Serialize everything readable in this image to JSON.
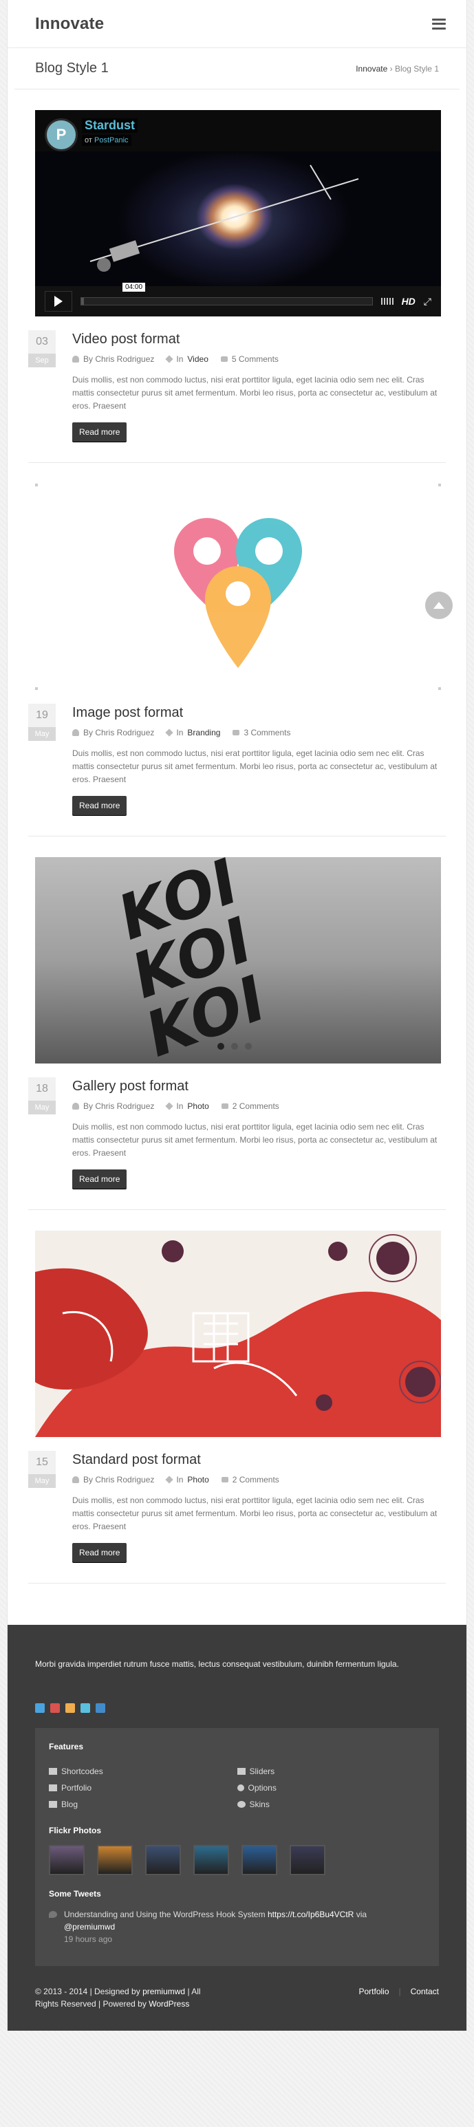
{
  "header": {
    "logo": "Innovate"
  },
  "title_bar": {
    "title": "Blog Style 1",
    "breadcrumb_home": "Innovate",
    "breadcrumb_sep": "›",
    "breadcrumb_current": "Blog Style 1"
  },
  "video": {
    "title": "Stardust",
    "by": "от",
    "author": "PostPanic",
    "avatar_letter": "P",
    "timecode": "04:00",
    "hd": "HD",
    "progress": 0.01
  },
  "posts": [
    {
      "day": "03",
      "month": "Sep",
      "title": "Video post format",
      "author": "By Chris Rodriguez",
      "in_label": "In",
      "category": "Video",
      "comments": "5 Comments",
      "excerpt": "Duis mollis, est non commodo luctus, nisi erat porttitor ligula, eget lacinia odio sem nec elit. Cras mattis consectetur purus sit amet fermentum. Morbi leo risus, porta ac consectetur ac, vestibulum at eros. Praesent",
      "read_more": "Read more"
    },
    {
      "day": "19",
      "month": "May",
      "title": "Image post format",
      "author": "By Chris Rodriguez",
      "in_label": "In",
      "category": "Branding",
      "comments": "3 Comments",
      "excerpt": "Duis mollis, est non commodo luctus, nisi erat porttitor ligula, eget lacinia odio sem nec elit. Cras mattis consectetur purus sit amet fermentum. Morbi leo risus, porta ac consectetur ac, vestibulum at eros. Praesent",
      "read_more": "Read more"
    },
    {
      "day": "18",
      "month": "May",
      "title": "Gallery post format",
      "author": "By Chris Rodriguez",
      "in_label": "In",
      "category": "Photo",
      "comments": "2 Comments",
      "excerpt": "Duis mollis, est non commodo luctus, nisi erat porttitor ligula, eget lacinia odio sem nec elit. Cras mattis consectetur purus sit amet fermentum. Morbi leo risus, porta ac consectetur ac, vestibulum at eros. Praesent",
      "read_more": "Read more"
    },
    {
      "day": "15",
      "month": "May",
      "title": "Standard post format",
      "author": "By Chris Rodriguez",
      "in_label": "In",
      "category": "Photo",
      "comments": "2 Comments",
      "excerpt": "Duis mollis, est non commodo luctus, nisi erat porttitor ligula, eget lacinia odio sem nec elit. Cras mattis consectetur purus sit amet fermentum. Morbi leo risus, porta ac consectetur ac, vestibulum at eros. Praesent",
      "read_more": "Read more"
    }
  ],
  "gallery_text": "KOI",
  "footer": {
    "text": "Morbi gravida imperdiet rutrum fusce mattis, lectus consequat vestibulum, duinibh fermentum ligula.",
    "social_colors": [
      "#4aa3df",
      "#d9534f",
      "#f0ad4e",
      "#5bc0de",
      "#428bca"
    ],
    "features_title": "Features",
    "features": [
      "Shortcodes",
      "Sliders",
      "Portfolio",
      "Options",
      "Blog",
      "Skins"
    ],
    "flickr_title": "Flickr Photos",
    "flickr_colors": [
      "#6b5a7a",
      "#c9822f",
      "#3c4f70",
      "#2d6b8c",
      "#2b5d94",
      "#3b3b55"
    ],
    "tweets_title": "Some Tweets",
    "tweet_text": "Understanding and Using the WordPress Hook System",
    "tweet_link": "https://t.co/Ip6Bu4VCtR",
    "tweet_via": "via",
    "tweet_handle": "@premiumwd",
    "tweet_ago": "19 hours ago",
    "copyright": "© 2013 - 2014 | Designed by",
    "designer": "premiumwd",
    "all": "| All",
    "rights": "Rights Reserved | Powered by",
    "powered": "WordPress",
    "link_portfolio": "Portfolio",
    "link_sep": "|",
    "link_contact": "Contact"
  }
}
